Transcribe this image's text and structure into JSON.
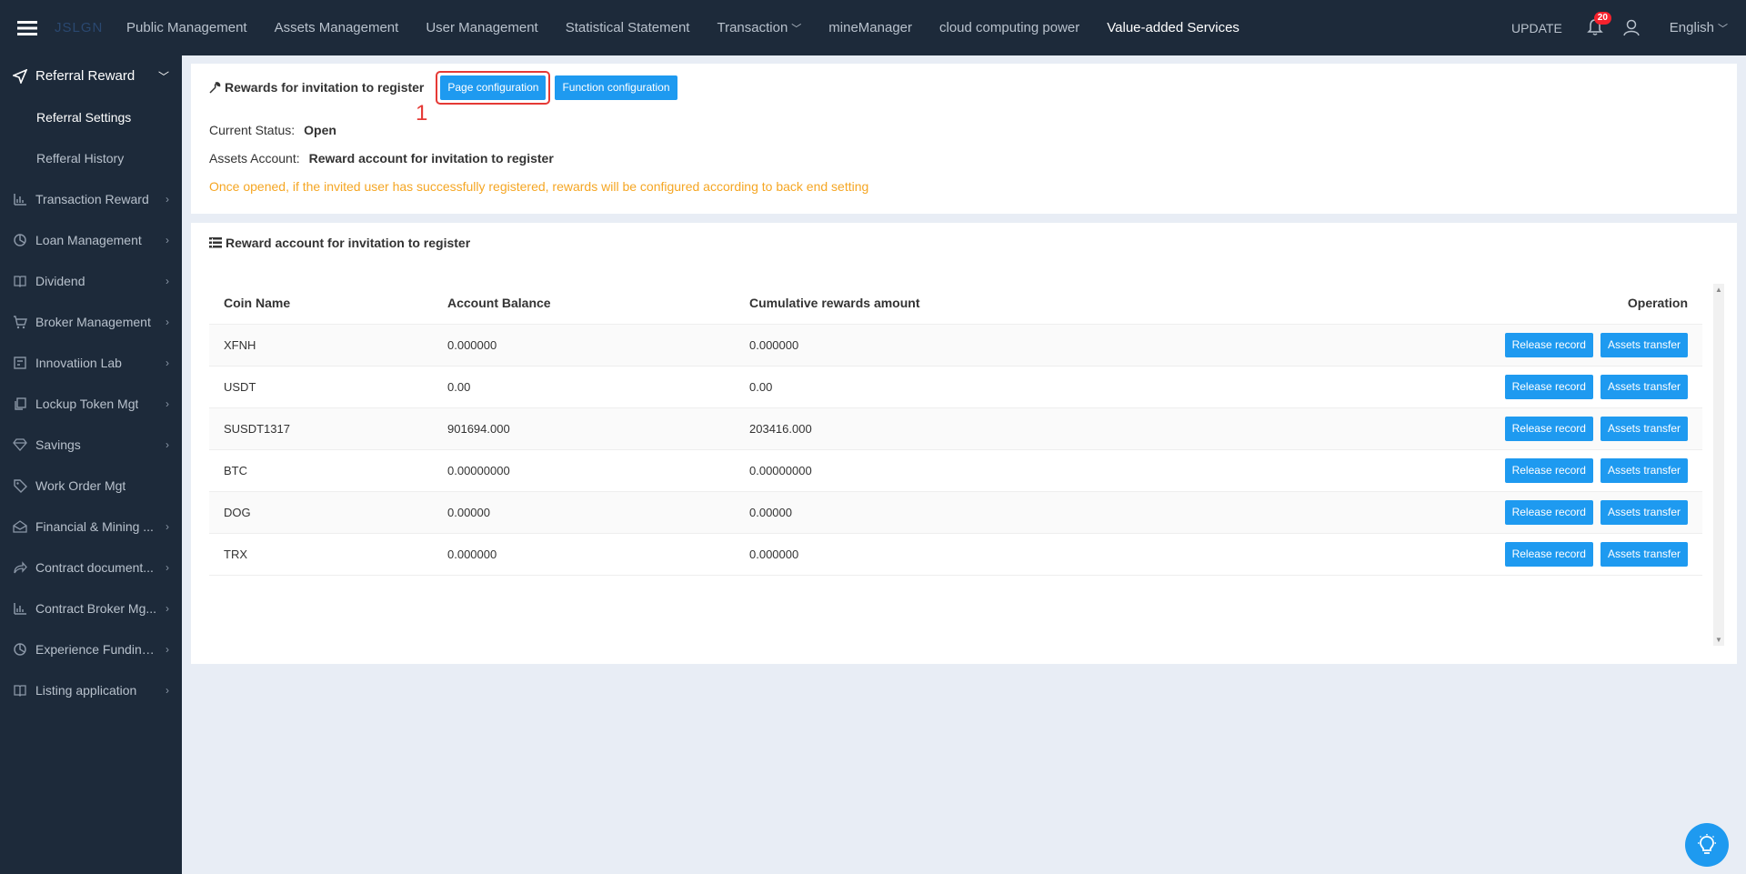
{
  "topbar": {
    "logo": "JSLGN",
    "nav": [
      {
        "label": "Public Management"
      },
      {
        "label": "Assets Management"
      },
      {
        "label": "User Management"
      },
      {
        "label": "Statistical Statement"
      },
      {
        "label": "Transaction"
      },
      {
        "label": "mineManager"
      },
      {
        "label": "cloud computing power"
      },
      {
        "label": "Value-added Services"
      }
    ],
    "update_label": "UPDATE",
    "notification_count": "20",
    "language": "English"
  },
  "sidebar": {
    "open_group": "Referral Reward",
    "sub_items": [
      {
        "label": "Referral Settings"
      },
      {
        "label": "Refferal History"
      }
    ],
    "items": [
      {
        "label": "Transaction Reward"
      },
      {
        "label": "Loan Management"
      },
      {
        "label": "Dividend"
      },
      {
        "label": "Broker Management"
      },
      {
        "label": "Innovatiion Lab"
      },
      {
        "label": "Lockup Token Mgt"
      },
      {
        "label": "Savings"
      },
      {
        "label": "Work Order Mgt"
      },
      {
        "label": "Financial & Mining ..."
      },
      {
        "label": "Contract document..."
      },
      {
        "label": "Contract Broker Mg..."
      },
      {
        "label": "Experience Funding..."
      },
      {
        "label": "Listing application"
      }
    ]
  },
  "config_panel": {
    "title": "Rewards for invitation to register",
    "page_config_label": "Page configuration",
    "function_config_label": "Function configuration",
    "marker": "1",
    "status_label": "Current Status:",
    "status_value": "Open",
    "account_label": "Assets Account:",
    "account_value": "Reward account for invitation to register",
    "notice": "Once opened, if the invited user has successfully registered, rewards will be configured according to back end setting"
  },
  "account_panel": {
    "title": "Reward account for invitation to register",
    "columns": {
      "coin": "Coin Name",
      "balance": "Account Balance",
      "cumulative": "Cumulative rewards amount",
      "operation": "Operation"
    },
    "release_label": "Release record",
    "transfer_label": "Assets transfer",
    "rows": [
      {
        "coin": "XFNH",
        "balance": "0.000000",
        "cumulative": "0.000000"
      },
      {
        "coin": "USDT",
        "balance": "0.00",
        "cumulative": "0.00"
      },
      {
        "coin": "SUSDT1317",
        "balance": "901694.000",
        "cumulative": "203416.000"
      },
      {
        "coin": "BTC",
        "balance": "0.00000000",
        "cumulative": "0.00000000"
      },
      {
        "coin": "DOG",
        "balance": "0.00000",
        "cumulative": "0.00000"
      },
      {
        "coin": "TRX",
        "balance": "0.000000",
        "cumulative": "0.000000"
      }
    ]
  },
  "colors": {
    "topbar_bg": "#1d2a3a",
    "primary_button": "#1e9af0",
    "notice": "#f5a623",
    "highlight": "#e53935"
  }
}
